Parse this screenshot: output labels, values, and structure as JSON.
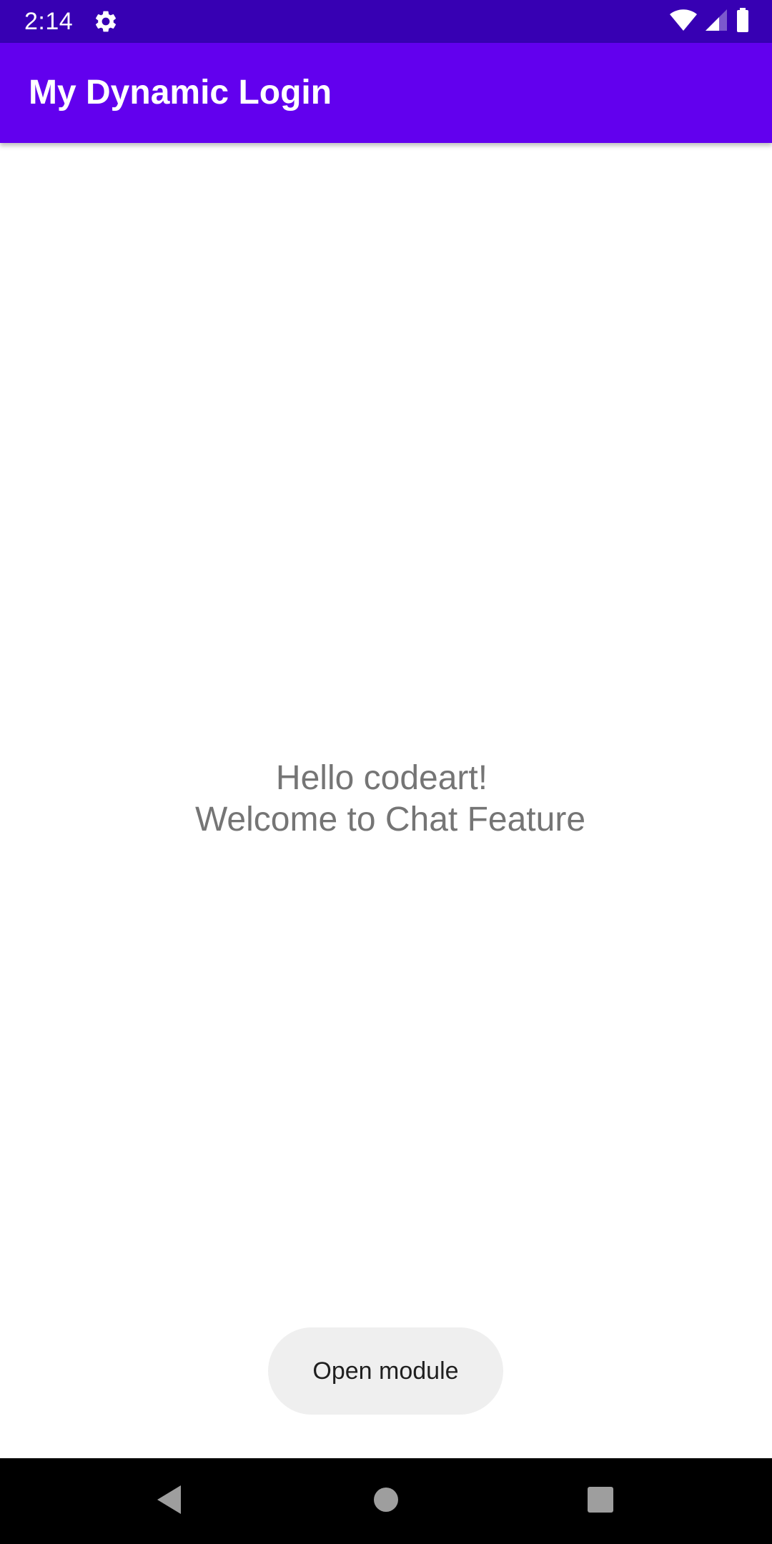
{
  "status_bar": {
    "time": "2:14",
    "icons": [
      "gear-icon",
      "wifi-icon",
      "signal-icon",
      "battery-icon"
    ],
    "background": "#3700b3"
  },
  "app_bar": {
    "title": "My Dynamic Login",
    "background": "#6200ee"
  },
  "content": {
    "welcome_line1": "Hello codeart!",
    "welcome_line2": "Welcome to Chat Feature",
    "text_color": "#757575"
  },
  "open_button": {
    "label": "Open module",
    "background": "#efefef"
  },
  "nav_bar": {
    "icons": [
      "back-icon",
      "home-icon",
      "recents-icon"
    ],
    "background": "#000000"
  }
}
